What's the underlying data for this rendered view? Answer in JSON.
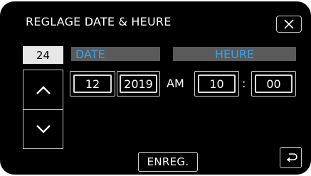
{
  "header": {
    "title": "REGLAGE DATE & HEURE",
    "close_icon": "close-icon"
  },
  "selector": {
    "counter_value": "24",
    "up_icon": "chevron-up-icon",
    "down_icon": "chevron-down-icon"
  },
  "date": {
    "label": "DATE",
    "month": "12",
    "year": "2019"
  },
  "time": {
    "label": "HEURE",
    "ampm": "AM",
    "hour": "10",
    "separator": ":",
    "minute": "00"
  },
  "footer": {
    "save_label": "ENREG.",
    "back_icon": "back-icon"
  },
  "colors": {
    "background": "#000000",
    "accent_label": "#33a3f1",
    "bar": "#5a5a5a",
    "counter_bg": "#e7e7e7"
  }
}
